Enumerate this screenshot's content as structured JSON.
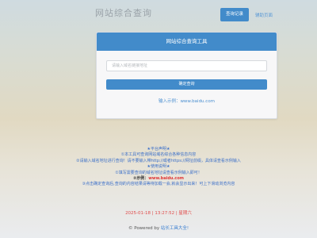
{
  "header": {
    "site_title": "网站综合查询",
    "history_button": "查询记录",
    "help_link": "辅助页面"
  },
  "card": {
    "title": "网站综合查询工具",
    "input_placeholder": "请输入域名链接地址",
    "submit_label": "确定查询",
    "example": "输入示例：www.baidu.com"
  },
  "notice": {
    "lines": [
      "★平台声明★",
      "①本工具可查询网站域名综合各种信息内容",
      "②请输入域名地址进行查询！请不要输入带http://或者https://网址前缀，具体请查看示例输入",
      "★使用说明★",
      "①填写需要查询的域名地址请查看示例输入即可！"
    ],
    "example_prefix": "②示例：",
    "example_url": "www.baidu.com",
    "last_line": "③点击确定查询后,查询的内容结果请等待加载一会,就会显示出来！可上下滑动浏览内容"
  },
  "datetime": "2025-01-18 | 13:27:52 | 星期六",
  "footer": {
    "prefix": "© Powered by ",
    "brand": "站长工具大全!"
  }
}
